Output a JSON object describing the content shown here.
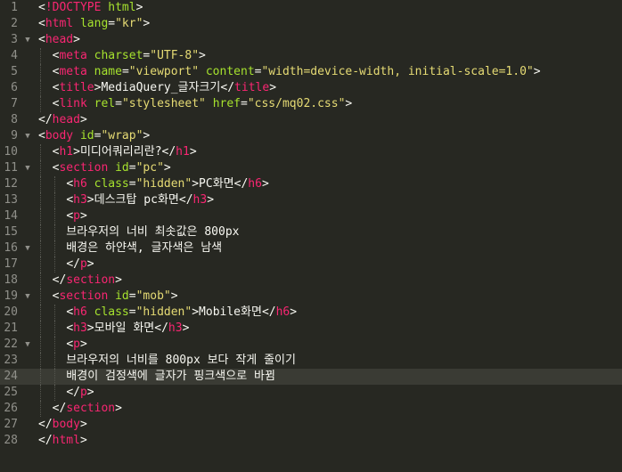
{
  "editor": {
    "theme_colors": {
      "background": "#272822",
      "tag": "#f92672",
      "attribute": "#a6e22e",
      "string": "#e6db74",
      "text": "#f8f8f2",
      "gutter": "#90908a",
      "active_line": "#3a3b34"
    },
    "active_line_number": "24",
    "fold_markers": [
      "3",
      "9",
      "11",
      "16",
      "19",
      "22"
    ],
    "lines": [
      {
        "n": "1",
        "tokens": [
          [
            "p",
            "<"
          ],
          [
            "t",
            "!DOCTYPE "
          ],
          [
            "a",
            "html"
          ],
          [
            "p",
            ">"
          ]
        ]
      },
      {
        "n": "2",
        "tokens": [
          [
            "p",
            "<"
          ],
          [
            "t",
            "html "
          ],
          [
            "a",
            "lang"
          ],
          [
            "p",
            "="
          ],
          [
            "s",
            "\"kr\""
          ],
          [
            "p",
            ">"
          ]
        ]
      },
      {
        "n": "3",
        "tokens": [
          [
            "p",
            "<"
          ],
          [
            "t",
            "head"
          ],
          [
            "p",
            ">"
          ]
        ]
      },
      {
        "n": "4",
        "tokens": [
          [
            "x",
            "  "
          ],
          [
            "p",
            "<"
          ],
          [
            "t",
            "meta "
          ],
          [
            "a",
            "charset"
          ],
          [
            "p",
            "="
          ],
          [
            "s",
            "\"UTF-8\""
          ],
          [
            "p",
            ">"
          ]
        ]
      },
      {
        "n": "5",
        "tokens": [
          [
            "x",
            "  "
          ],
          [
            "p",
            "<"
          ],
          [
            "t",
            "meta "
          ],
          [
            "a",
            "name"
          ],
          [
            "p",
            "="
          ],
          [
            "s",
            "\"viewport\" "
          ],
          [
            "a",
            "content"
          ],
          [
            "p",
            "="
          ],
          [
            "s",
            "\"width=device-width, initial-scale=1.0\""
          ],
          [
            "p",
            ">"
          ]
        ]
      },
      {
        "n": "6",
        "tokens": [
          [
            "x",
            "  "
          ],
          [
            "p",
            "<"
          ],
          [
            "t",
            "title"
          ],
          [
            "p",
            ">"
          ],
          [
            "x",
            "MediaQuery_글자크기"
          ],
          [
            "p",
            "</"
          ],
          [
            "t",
            "title"
          ],
          [
            "p",
            ">"
          ]
        ]
      },
      {
        "n": "7",
        "tokens": [
          [
            "x",
            "  "
          ],
          [
            "p",
            "<"
          ],
          [
            "t",
            "link "
          ],
          [
            "a",
            "rel"
          ],
          [
            "p",
            "="
          ],
          [
            "s",
            "\"stylesheet\" "
          ],
          [
            "a",
            "href"
          ],
          [
            "p",
            "="
          ],
          [
            "s",
            "\"css/mq02.css\""
          ],
          [
            "p",
            ">"
          ]
        ]
      },
      {
        "n": "8",
        "tokens": [
          [
            "p",
            "</"
          ],
          [
            "t",
            "head"
          ],
          [
            "p",
            ">"
          ]
        ]
      },
      {
        "n": "9",
        "tokens": [
          [
            "p",
            "<"
          ],
          [
            "t",
            "body "
          ],
          [
            "a",
            "id"
          ],
          [
            "p",
            "="
          ],
          [
            "s",
            "\"wrap\""
          ],
          [
            "p",
            ">"
          ]
        ]
      },
      {
        "n": "10",
        "tokens": [
          [
            "x",
            "  "
          ],
          [
            "p",
            "<"
          ],
          [
            "t",
            "h1"
          ],
          [
            "p",
            ">"
          ],
          [
            "x",
            "미디어쿼리리란?"
          ],
          [
            "p",
            "</"
          ],
          [
            "t",
            "h1"
          ],
          [
            "p",
            ">"
          ]
        ]
      },
      {
        "n": "11",
        "tokens": [
          [
            "x",
            "  "
          ],
          [
            "p",
            "<"
          ],
          [
            "t",
            "section "
          ],
          [
            "a",
            "id"
          ],
          [
            "p",
            "="
          ],
          [
            "s",
            "\"pc\""
          ],
          [
            "p",
            ">"
          ]
        ]
      },
      {
        "n": "12",
        "tokens": [
          [
            "x",
            "    "
          ],
          [
            "p",
            "<"
          ],
          [
            "t",
            "h6 "
          ],
          [
            "a",
            "class"
          ],
          [
            "p",
            "="
          ],
          [
            "s",
            "\"hidden\""
          ],
          [
            "p",
            ">"
          ],
          [
            "x",
            "PC화면"
          ],
          [
            "p",
            "</"
          ],
          [
            "t",
            "h6"
          ],
          [
            "p",
            ">"
          ]
        ]
      },
      {
        "n": "13",
        "tokens": [
          [
            "x",
            "    "
          ],
          [
            "p",
            "<"
          ],
          [
            "t",
            "h3"
          ],
          [
            "p",
            ">"
          ],
          [
            "x",
            "데스크탑 pc화면"
          ],
          [
            "p",
            "</"
          ],
          [
            "t",
            "h3"
          ],
          [
            "p",
            ">"
          ]
        ]
      },
      {
        "n": "14",
        "tokens": [
          [
            "x",
            "    "
          ],
          [
            "p",
            "<"
          ],
          [
            "t",
            "p"
          ],
          [
            "p",
            ">"
          ]
        ]
      },
      {
        "n": "15",
        "tokens": [
          [
            "x",
            "    브라우저의 너비 최솟값은 800px"
          ]
        ]
      },
      {
        "n": "16",
        "tokens": [
          [
            "x",
            "    배경은 하얀색, 글자색은 남색"
          ]
        ]
      },
      {
        "n": "17",
        "tokens": [
          [
            "x",
            "    "
          ],
          [
            "p",
            "</"
          ],
          [
            "t",
            "p"
          ],
          [
            "p",
            ">"
          ]
        ]
      },
      {
        "n": "18",
        "tokens": [
          [
            "x",
            "  "
          ],
          [
            "p",
            "</"
          ],
          [
            "t",
            "section"
          ],
          [
            "p",
            ">"
          ]
        ]
      },
      {
        "n": "19",
        "tokens": [
          [
            "x",
            "  "
          ],
          [
            "p",
            "<"
          ],
          [
            "t",
            "section "
          ],
          [
            "a",
            "id"
          ],
          [
            "p",
            "="
          ],
          [
            "s",
            "\"mob\""
          ],
          [
            "p",
            ">"
          ]
        ]
      },
      {
        "n": "20",
        "tokens": [
          [
            "x",
            "    "
          ],
          [
            "p",
            "<"
          ],
          [
            "t",
            "h6 "
          ],
          [
            "a",
            "class"
          ],
          [
            "p",
            "="
          ],
          [
            "s",
            "\"hidden\""
          ],
          [
            "p",
            ">"
          ],
          [
            "x",
            "Mobile화면"
          ],
          [
            "p",
            "</"
          ],
          [
            "t",
            "h6"
          ],
          [
            "p",
            ">"
          ]
        ]
      },
      {
        "n": "21",
        "tokens": [
          [
            "x",
            "    "
          ],
          [
            "p",
            "<"
          ],
          [
            "t",
            "h3"
          ],
          [
            "p",
            ">"
          ],
          [
            "x",
            "모바일 화면"
          ],
          [
            "p",
            "</"
          ],
          [
            "t",
            "h3"
          ],
          [
            "p",
            ">"
          ]
        ]
      },
      {
        "n": "22",
        "tokens": [
          [
            "x",
            "    "
          ],
          [
            "p",
            "<"
          ],
          [
            "t",
            "p"
          ],
          [
            "p",
            ">"
          ]
        ]
      },
      {
        "n": "23",
        "tokens": [
          [
            "x",
            "    브라우저의 너비를 800px 보다 작게 줄이기"
          ]
        ]
      },
      {
        "n": "24",
        "tokens": [
          [
            "x",
            "    배경이 검정색에 글자가 핑크색으로 바뀜"
          ]
        ]
      },
      {
        "n": "25",
        "tokens": [
          [
            "x",
            "    "
          ],
          [
            "p",
            "</"
          ],
          [
            "t",
            "p"
          ],
          [
            "p",
            ">"
          ]
        ]
      },
      {
        "n": "26",
        "tokens": [
          [
            "x",
            "  "
          ],
          [
            "p",
            "</"
          ],
          [
            "t",
            "section"
          ],
          [
            "p",
            ">"
          ]
        ]
      },
      {
        "n": "27",
        "tokens": [
          [
            "p",
            "</"
          ],
          [
            "t",
            "body"
          ],
          [
            "p",
            ">"
          ]
        ]
      },
      {
        "n": "28",
        "tokens": [
          [
            "p",
            "</"
          ],
          [
            "t",
            "html"
          ],
          [
            "p",
            ">"
          ]
        ]
      }
    ]
  }
}
